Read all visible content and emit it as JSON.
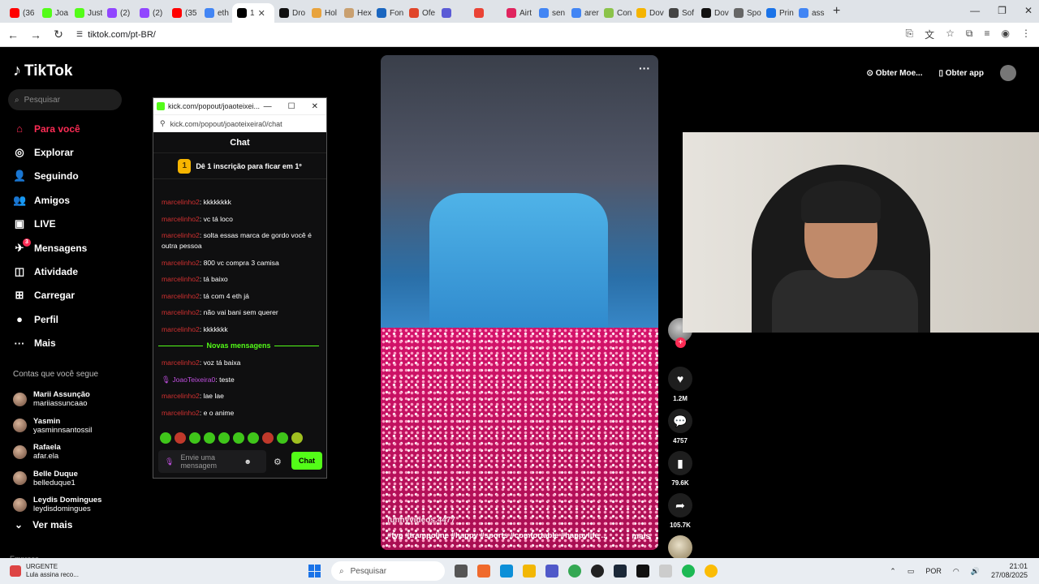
{
  "browser": {
    "tabs": [
      {
        "label": "(36",
        "color": "#ff0000"
      },
      {
        "label": "Joa",
        "color": "#53fc18"
      },
      {
        "label": "Just",
        "color": "#53fc18"
      },
      {
        "label": "(2)",
        "color": "#9146ff"
      },
      {
        "label": "(2)",
        "color": "#9146ff"
      },
      {
        "label": "(35",
        "color": "#ff0000"
      },
      {
        "label": "eth",
        "color": "#4285f4"
      },
      {
        "label": "1",
        "color": "#000000",
        "active": true
      },
      {
        "label": "Dro",
        "color": "#111111"
      },
      {
        "label": "Hol",
        "color": "#e8a33d"
      },
      {
        "label": "Hex",
        "color": "#c9a070"
      },
      {
        "label": "Fon",
        "color": "#1a66c0"
      },
      {
        "label": "Ofe",
        "color": "#e0452a"
      },
      {
        "label": "",
        "color": "#5b5bd6"
      },
      {
        "label": "",
        "color": "#ea4335"
      },
      {
        "label": "Airt",
        "color": "#e0245e"
      },
      {
        "label": "sen",
        "color": "#4285f4"
      },
      {
        "label": "arer",
        "color": "#4285f4"
      },
      {
        "label": "Con",
        "color": "#8bc34a"
      },
      {
        "label": "Dov",
        "color": "#f5b400"
      },
      {
        "label": "Sof",
        "color": "#444444"
      },
      {
        "label": "Dov",
        "color": "#111111"
      },
      {
        "label": "Spo",
        "color": "#666666"
      },
      {
        "label": "Prin",
        "color": "#1a73e8"
      },
      {
        "label": "ass",
        "color": "#4285f4"
      }
    ],
    "new_tab": "+",
    "url": "tiktok.com/pt-BR/"
  },
  "tiktok": {
    "logo": "TikTok",
    "search_placeholder": "Pesquisar",
    "nav": [
      {
        "label": "Para você",
        "icon": "home-icon",
        "glyph": "⌂",
        "active": true
      },
      {
        "label": "Explorar",
        "icon": "compass-icon",
        "glyph": "◎"
      },
      {
        "label": "Seguindo",
        "icon": "following-icon",
        "glyph": "👤"
      },
      {
        "label": "Amigos",
        "icon": "friends-icon",
        "glyph": "👥"
      },
      {
        "label": "LIVE",
        "icon": "live-icon",
        "glyph": "▣"
      },
      {
        "label": "Mensagens",
        "icon": "messages-icon",
        "glyph": "✈"
      },
      {
        "label": "Atividade",
        "icon": "activity-icon",
        "glyph": "◫"
      },
      {
        "label": "Carregar",
        "icon": "upload-icon",
        "glyph": "⊞"
      },
      {
        "label": "Perfil",
        "icon": "profile-icon",
        "glyph": "●"
      },
      {
        "label": "Mais",
        "icon": "more-icon",
        "glyph": "···"
      }
    ],
    "messages_badge": "3",
    "following_title": "Contas que você segue",
    "following": [
      {
        "name": "Marii Assunção",
        "handle": "mariiassuncaao"
      },
      {
        "name": "Yasmin",
        "handle": "yasminnsantossil"
      },
      {
        "name": "Rafaela",
        "handle": "afar.ela"
      },
      {
        "name": "Belle Duque",
        "handle": "belleduque1"
      },
      {
        "name": "Leydis Domingues",
        "handle": "leydisdomingues"
      }
    ],
    "see_more": "Ver mais",
    "footer_text": "Empresa",
    "top_right": {
      "coins": "Obter Moe...",
      "app": "Obter app"
    },
    "video": {
      "author": "funnyvideos.4477",
      "tags": "#fyp #trampoline #happy #sports #comfortable #happylife ...",
      "more": "mais",
      "likes": "1.2M",
      "comments": "4757",
      "saves": "79.6K",
      "shares": "105.7K"
    }
  },
  "kick_popup": {
    "title": "kick.com/popout/joaoteixei...",
    "url": "kick.com/popout/joaoteixeira0/chat",
    "chat_header": "Chat",
    "sub_badge": "1",
    "sub_text": "Dê 1 inscrição para ficar em 1º",
    "messages": [
      {
        "user": "marcelinho2",
        "text": ": kkkkkkkk"
      },
      {
        "user": "marcelinho2",
        "text": ": vc tá loco"
      },
      {
        "user": "marcelinho2",
        "text": ": solta essas marca de gordo você é outra pessoa"
      },
      {
        "user": "marcelinho2",
        "text": ": 800 vc compra 3 camisa"
      },
      {
        "user": "marcelinho2",
        "text": ": tá baixo"
      },
      {
        "user": "marcelinho2",
        "text": ": tá com 4 eth já"
      },
      {
        "user": "marcelinho2",
        "text": ": não vai bani sem querer"
      },
      {
        "user": "marcelinho2",
        "text": ": kkkkkkk"
      }
    ],
    "new_messages_label": "Novas mensagens",
    "new_messages": [
      {
        "user": "marcelinho2",
        "text": ": voz tá baixa"
      },
      {
        "user": "JoaoTeixeira0",
        "text": ": teste",
        "streamer": true
      },
      {
        "user": "marcelinho2",
        "text": ": lae lae"
      },
      {
        "user": "marcelinho2",
        "text": ": e o anime"
      }
    ],
    "input_placeholder": "Envie uma mensagem",
    "send_label": "Chat",
    "accent": "#53fc18"
  },
  "taskbar": {
    "news_title": "URGENTE",
    "news_sub": "Lula assina reco...",
    "search": "Pesquisar",
    "lang": "POR",
    "time": "21:01",
    "date": "27/08/2025"
  }
}
